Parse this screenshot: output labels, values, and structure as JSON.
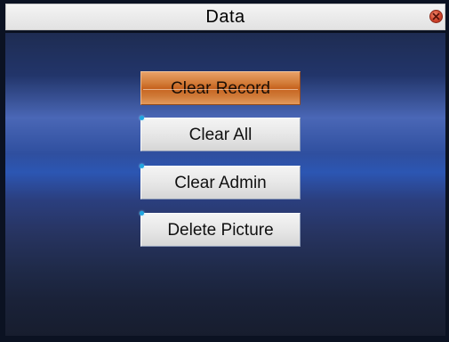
{
  "window": {
    "title": "Data"
  },
  "menu": {
    "items": [
      {
        "label": "Clear Record",
        "selected": true
      },
      {
        "label": "Clear All",
        "selected": false
      },
      {
        "label": "Clear Admin",
        "selected": false
      },
      {
        "label": "Delete Picture",
        "selected": false
      }
    ]
  },
  "icons": {
    "close": "close-icon"
  },
  "colors": {
    "selected_item": "#c7631f",
    "button_face": "#e7e7e7",
    "background_blue": "#2c56b3",
    "close_red": "#d2452c"
  }
}
